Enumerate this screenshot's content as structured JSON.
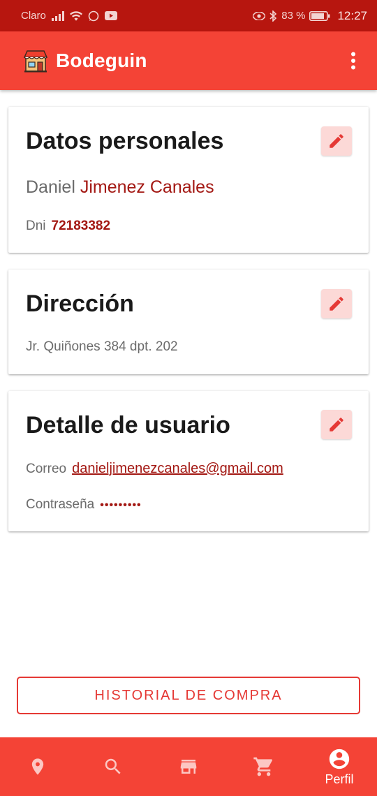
{
  "status_bar": {
    "carrier": "Claro",
    "battery": "83 %",
    "time": "12:27"
  },
  "app_bar": {
    "title": "Bodeguin"
  },
  "personal": {
    "title": "Datos personales",
    "first_name": "Daniel",
    "last_name": "Jimenez Canales",
    "dni_label": "Dni",
    "dni_value": "72183382"
  },
  "address": {
    "title": "Dirección",
    "value": "Jr. Quiñones 384 dpt. 202"
  },
  "user_detail": {
    "title": "Detalle de usuario",
    "email_label": "Correo",
    "email_value": "danieljimenezcanales@gmail.com",
    "password_label": "Contraseña",
    "password_value": "•••••••••"
  },
  "history_button": "HISTORIAL DE COMPRA",
  "bottom_nav": {
    "items": [
      {
        "icon": "location-pin-icon",
        "label": ""
      },
      {
        "icon": "search-icon",
        "label": ""
      },
      {
        "icon": "store-icon",
        "label": ""
      },
      {
        "icon": "cart-icon",
        "label": ""
      },
      {
        "icon": "account-icon",
        "label": "Perfil"
      }
    ],
    "active_index": 4
  },
  "colors": {
    "primary": "#f44336",
    "status_bar": "#b7160f",
    "accent_text": "#a31813",
    "edit_button_bg": "#fcd9d7"
  }
}
